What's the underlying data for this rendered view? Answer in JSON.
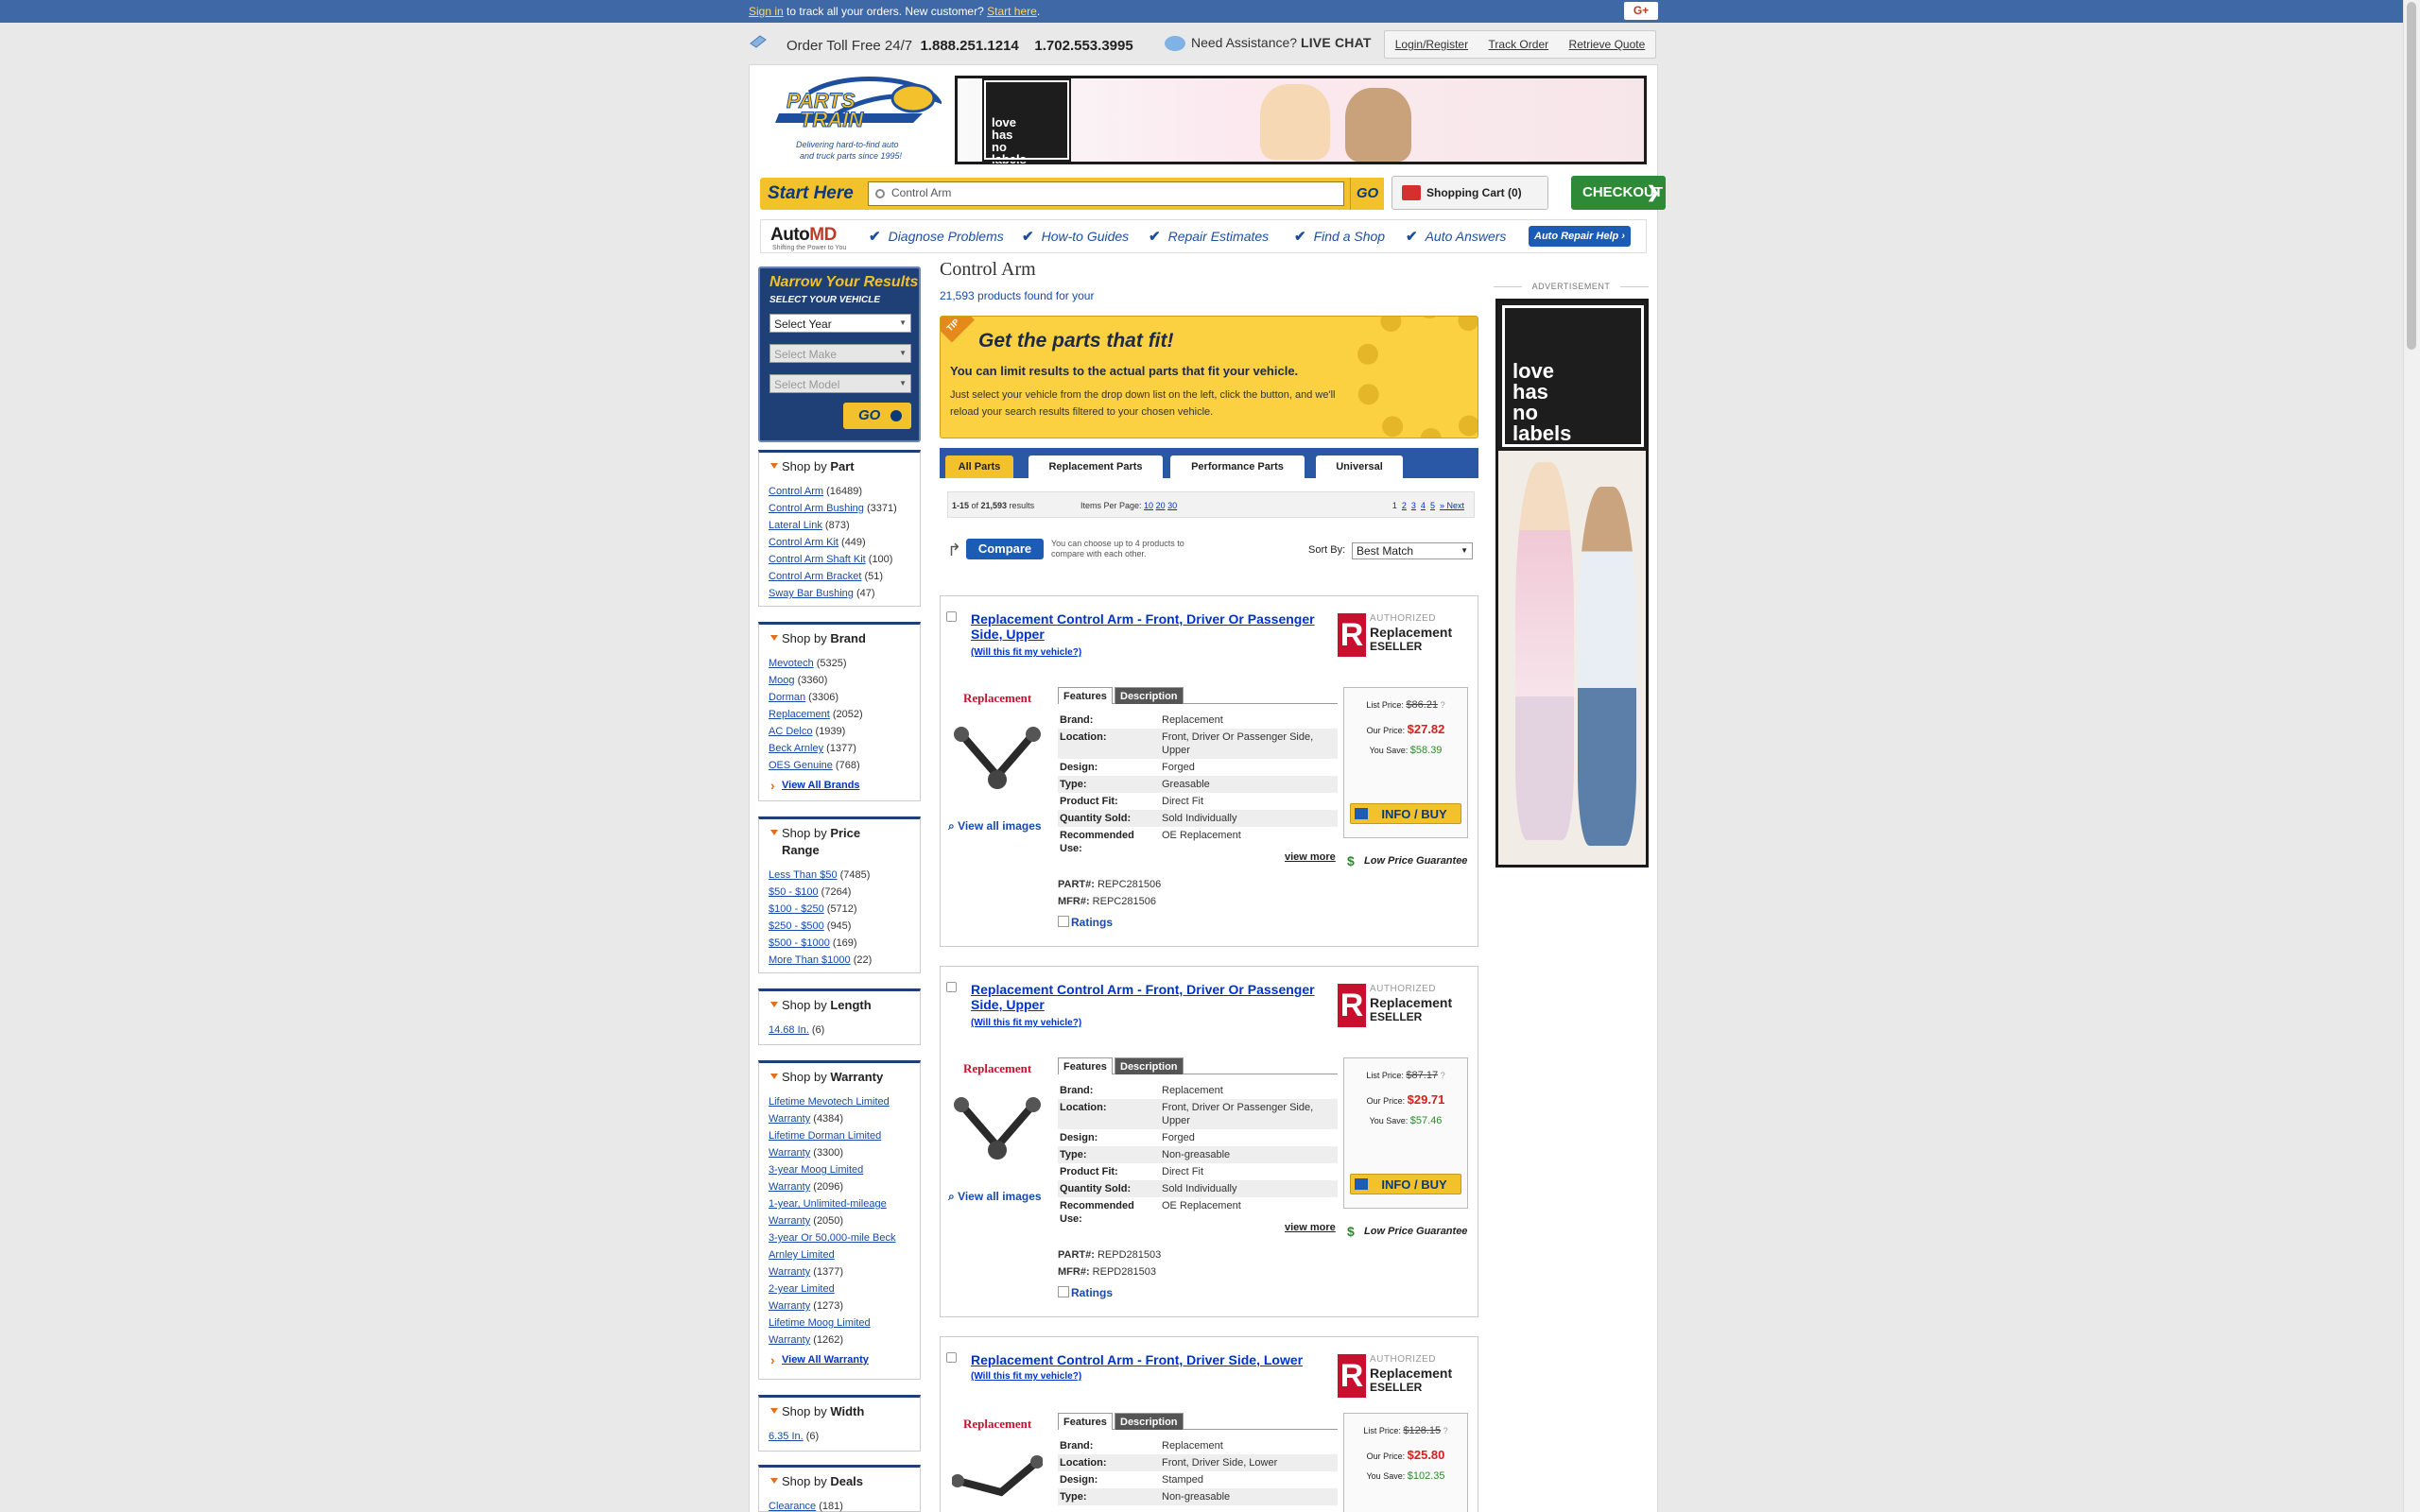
{
  "topbar": {
    "signin_link": "Sign in",
    "signin_text": " to track all your orders. New customer? ",
    "start_link": "Start here",
    "start_tail": ".",
    "gplus": "G+"
  },
  "header": {
    "order_label": "Order Toll Free 24/7",
    "phone1": "1.888.251.1214",
    "phone2": "1.702.553.3995",
    "assist_label": "Need Assistance?",
    "live_chat": "LIVE CHAT",
    "links": [
      "Login/Register",
      "Track Order",
      "Retrieve Quote"
    ]
  },
  "logo": {
    "name_top": "PARTS",
    "name_bottom": "TRAIN",
    "tagline1": "Delivering hard-to-find auto",
    "tagline2": "and truck parts since 1995!"
  },
  "banner": {
    "text1": "love",
    "text2": "has",
    "text3": "no",
    "text4": "labels"
  },
  "search": {
    "start_here": "Start Here",
    "value": "Control Arm",
    "go": "GO",
    "cart": "Shopping Cart (0)",
    "checkout": "CHECKOUT"
  },
  "automd": {
    "logo_a": "Auto",
    "logo_b": "MD",
    "sub": "Shifting the Power to You",
    "items": [
      "Diagnose Problems",
      "How-to Guides",
      "Repair Estimates",
      "Find a Shop",
      "Auto Answers"
    ],
    "cta": "Auto Repair Help ›"
  },
  "narrow": {
    "title": "Narrow Your Results",
    "subtitle": "SELECT YOUR VEHICLE",
    "year": "Select Year",
    "make": "Select Make",
    "model": "Select Model",
    "go": "GO"
  },
  "facets": {
    "part": {
      "pre": "Shop by ",
      "name": "Part",
      "items": [
        {
          "label": "Control Arm",
          "count": " (16489)"
        },
        {
          "label": "Control Arm Bushing",
          "count": " (3371)"
        },
        {
          "label": "Lateral Link",
          "count": " (873)"
        },
        {
          "label": "Control Arm Kit",
          "count": " (449)"
        },
        {
          "label": "Control Arm Shaft Kit",
          "count": " (100)"
        },
        {
          "label": "Control Arm Bracket",
          "count": " (51)"
        },
        {
          "label": "Sway Bar Bushing",
          "count": " (47)"
        }
      ]
    },
    "brand": {
      "pre": "Shop by ",
      "name": "Brand",
      "items": [
        {
          "label": "Mevotech",
          "count": " (5325)"
        },
        {
          "label": "Moog",
          "count": " (3360)"
        },
        {
          "label": "Dorman",
          "count": " (3306)"
        },
        {
          "label": "Replacement",
          "count": " (2052)"
        },
        {
          "label": "AC Delco",
          "count": " (1939)"
        },
        {
          "label": "Beck Arnley",
          "count": " (1377)"
        },
        {
          "label": "OES Genuine",
          "count": " (768)"
        }
      ],
      "view_all": "View All Brands"
    },
    "price": {
      "pre": "Shop by ",
      "name": "Price",
      "name2": "Range",
      "items": [
        {
          "label": "Less Than $50",
          "count": " (7485)"
        },
        {
          "label": "$50 - $100",
          "count": " (7264)"
        },
        {
          "label": "$100 - $250",
          "count": " (5712)"
        },
        {
          "label": "$250 - $500",
          "count": " (945)"
        },
        {
          "label": "$500 - $1000",
          "count": " (169)"
        },
        {
          "label": "More Than $1000",
          "count": " (22)"
        }
      ]
    },
    "length": {
      "pre": "Shop by ",
      "name": "Length",
      "items": [
        {
          "label": "14.68 In.",
          "count": " (6)"
        }
      ]
    },
    "warranty": {
      "pre": "Shop by ",
      "name": "Warranty",
      "items": [
        {
          "l1": "Lifetime Mevotech Limited",
          "l2": "Warranty",
          "count": " (4384)"
        },
        {
          "l1": "Lifetime Dorman Limited",
          "l2": "Warranty",
          "count": " (3300)"
        },
        {
          "l1": "3-year Moog Limited",
          "l2": "Warranty",
          "count": " (2096)"
        },
        {
          "l1": "1-year, Unlimited-mileage",
          "l2": "Warranty",
          "count": " (2050)"
        },
        {
          "l1": "3-year Or 50,000-mile Beck",
          "l1b": "Arnley Limited",
          "l2": "Warranty",
          "count": " (1377)"
        },
        {
          "l1": "2-year Limited",
          "l2": "Warranty",
          "count": " (1273)"
        },
        {
          "l1": "Lifetime Moog Limited",
          "l2": "Warranty",
          "count": " (1262)"
        }
      ],
      "view_all": "View All Warranty"
    },
    "width": {
      "pre": "Shop by ",
      "name": "Width",
      "items": [
        {
          "label": "6.35 In.",
          "count": " (6)"
        }
      ]
    },
    "deals": {
      "pre": "Shop by ",
      "name": "Deals",
      "items": [
        {
          "label": "Clearance",
          "count": " (181)"
        }
      ]
    }
  },
  "main": {
    "title": "Control Arm",
    "found": "21,593 products found for your",
    "tip": {
      "badge": "TIP",
      "heading": "Get the parts that fit!",
      "sub": "You can limit results to the actual parts that fit your vehicle.",
      "body": "Just select your vehicle from the drop down list on the left, click the button, and we'll reload your search results filtered to your chosen vehicle."
    },
    "tabs": [
      "All Parts",
      "Replacement Parts",
      "Performance Parts",
      "Universal"
    ],
    "results": {
      "range": "1-15",
      "of": " of ",
      "total": "21,593",
      "suffix": " results",
      "ipp_label": "Items Per Page: ",
      "ipp": [
        "10",
        "20",
        "30"
      ],
      "pages": [
        "1",
        "2",
        "3",
        "4",
        "5"
      ],
      "next": "» Next"
    },
    "compare": {
      "button": "Compare",
      "note": "You can choose up to 4 products to compare with each other."
    },
    "sort": {
      "label": "Sort By:",
      "value": "Best Match"
    }
  },
  "products": [
    {
      "title": "Replacement Control Arm - Front, Driver Or Passenger Side, Upper",
      "fit": "(Will this fit my vehicle?)",
      "auth1": "AUTHORIZED",
      "auth2": "Replacement",
      "auth3": "ESELLER",
      "brand_logo": "Replacement",
      "view_images": "View all images",
      "tab_features": "Features",
      "tab_description": "Description",
      "specs": [
        {
          "k": "Brand:",
          "v": "Replacement"
        },
        {
          "k": "Location:",
          "v": "Front, Driver Or Passenger Side, Upper"
        },
        {
          "k": "Design:",
          "v": "Forged"
        },
        {
          "k": "Type:",
          "v": "Greasable"
        },
        {
          "k": "Product Fit:",
          "v": "Direct Fit"
        },
        {
          "k": "Quantity Sold:",
          "v": "Sold Individually"
        },
        {
          "k": "Recommended Use:",
          "v": "OE Replacement"
        }
      ],
      "view_more": "view more",
      "part_label": "PART#:",
      "part": "REPC281506",
      "mfr_label": "MFR#:",
      "mfr": "REPC281506",
      "ratings": "Ratings",
      "list_label": "List Price:",
      "list_price": "$86.21",
      "our_label": "Our Price:",
      "our_price": "$27.82",
      "save_label": "You Save:",
      "save": "$58.39",
      "info_buy": "INFO / BUY",
      "lpg": "Low Price Guarantee"
    },
    {
      "title": "Replacement Control Arm - Front, Driver Or Passenger Side, Upper",
      "fit": "(Will this fit my vehicle?)",
      "auth1": "AUTHORIZED",
      "auth2": "Replacement",
      "auth3": "ESELLER",
      "brand_logo": "Replacement",
      "view_images": "View all images",
      "tab_features": "Features",
      "tab_description": "Description",
      "specs": [
        {
          "k": "Brand:",
          "v": "Replacement"
        },
        {
          "k": "Location:",
          "v": "Front, Driver Or Passenger Side, Upper"
        },
        {
          "k": "Design:",
          "v": "Forged"
        },
        {
          "k": "Type:",
          "v": "Non-greasable"
        },
        {
          "k": "Product Fit:",
          "v": "Direct Fit"
        },
        {
          "k": "Quantity Sold:",
          "v": "Sold Individually"
        },
        {
          "k": "Recommended Use:",
          "v": "OE Replacement"
        }
      ],
      "view_more": "view more",
      "part_label": "PART#:",
      "part": "REPD281503",
      "mfr_label": "MFR#:",
      "mfr": "REPD281503",
      "ratings": "Ratings",
      "list_label": "List Price:",
      "list_price": "$87.17",
      "our_label": "Our Price:",
      "our_price": "$29.71",
      "save_label": "You Save:",
      "save": "$57.46",
      "info_buy": "INFO / BUY",
      "lpg": "Low Price Guarantee"
    },
    {
      "title": "Replacement Control Arm - Front, Driver Side, Lower",
      "fit": "(Will this fit my vehicle?)",
      "auth1": "AUTHORIZED",
      "auth2": "Replacement",
      "auth3": "ESELLER",
      "brand_logo": "Replacement",
      "tab_features": "Features",
      "tab_description": "Description",
      "specs": [
        {
          "k": "Brand:",
          "v": "Replacement"
        },
        {
          "k": "Location:",
          "v": "Front, Driver Side, Lower"
        },
        {
          "k": "Design:",
          "v": "Stamped"
        },
        {
          "k": "Type:",
          "v": "Non-greasable"
        }
      ],
      "list_label": "List Price:",
      "list_price": "$128.15",
      "our_label": "Our Price:",
      "our_price": "$25.80",
      "save_label": "You Save:",
      "save": "$102.35"
    }
  ],
  "ad": {
    "label": "ADVERTISEMENT",
    "text1": "love",
    "text2": "has",
    "text3": "no",
    "text4": "labels"
  }
}
